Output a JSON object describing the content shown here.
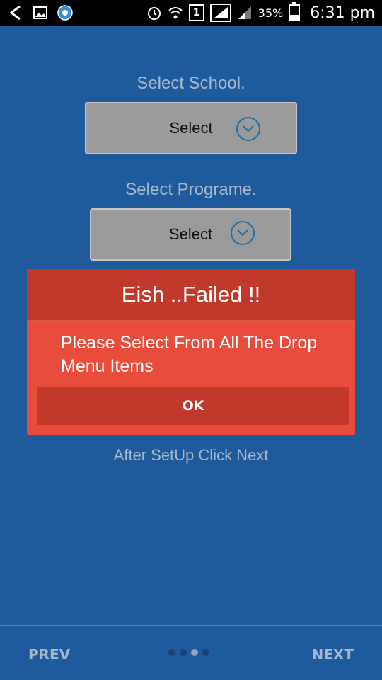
{
  "statusbar": {
    "sim_slot": "1",
    "battery_percent": "35%",
    "battery_level": 0.35,
    "time": "6:31 pm"
  },
  "school": {
    "label": "Select School.",
    "value": "Select"
  },
  "programe": {
    "label": "Select Programe.",
    "value": "Select"
  },
  "dialog": {
    "title": "Eish ..Failed !!",
    "message": "Please Select From All The Drop Menu Items",
    "ok_label": "OK"
  },
  "hint": "After SetUp Click Next",
  "footer": {
    "prev_label": "PREV",
    "next_label": "NEXT",
    "page_count": 4,
    "active_page": 3
  },
  "colors": {
    "background": "#1f5a9c",
    "dialog": "#e74c3c",
    "dialog_header": "#c0392b"
  }
}
